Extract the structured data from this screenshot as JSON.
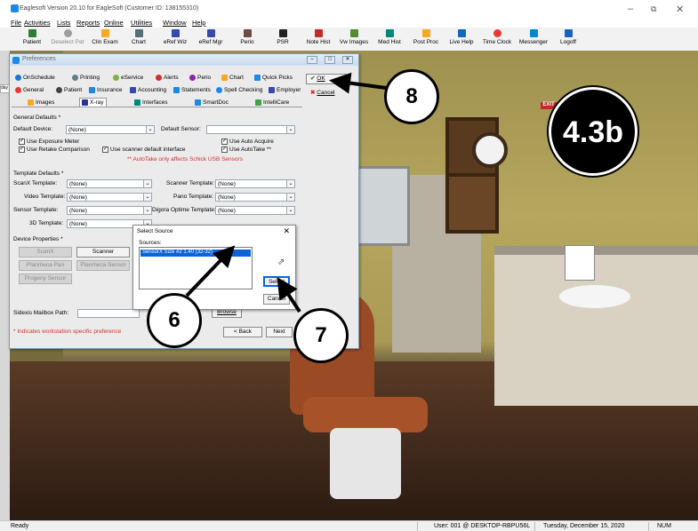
{
  "window": {
    "title": "Eaglesoft Version 20.10 for EagleSoft (Customer ID: 138155310)"
  },
  "menu": [
    "File",
    "Activities",
    "Lists",
    "Reports",
    "Online",
    "Utilities",
    "Window",
    "Help"
  ],
  "toolbar": [
    {
      "label": "Patient",
      "icon": "patient-icon",
      "color": "#2e7d32"
    },
    {
      "label": "Deselect Pat",
      "icon": "deselect-icon",
      "color": "#9e9e9e"
    },
    {
      "label": "Clin Exam",
      "icon": "clin-exam-icon",
      "color": "#f9a825"
    },
    {
      "label": "Chart",
      "icon": "chart-icon",
      "color": "#546e7a"
    },
    {
      "label": "eRef Wiz",
      "icon": "eref-wiz-icon",
      "color": "#3949ab"
    },
    {
      "label": "eRef Mgr",
      "icon": "eref-mgr-icon",
      "color": "#3949ab"
    },
    {
      "label": "Perio",
      "icon": "perio-icon",
      "color": "#6d4c41"
    },
    {
      "label": "PSR",
      "icon": "psr-icon",
      "color": "#212121"
    },
    {
      "label": "Note Hist",
      "icon": "note-hist-icon",
      "color": "#c62828"
    },
    {
      "label": "Vw Images",
      "icon": "images-icon",
      "color": "#558b2f"
    },
    {
      "label": "Med Hist",
      "icon": "med-hist-icon",
      "color": "#00897b"
    },
    {
      "label": "Post Proc",
      "icon": "post-proc-icon",
      "color": "#f9a825"
    },
    {
      "label": "Live Help",
      "icon": "live-help-icon",
      "color": "#1565c0"
    },
    {
      "label": "Time Clock",
      "icon": "time-clock-icon",
      "color": "#e53935"
    },
    {
      "label": "Messenger",
      "icon": "messenger-icon",
      "color": "#0288d1"
    },
    {
      "label": "Logoff",
      "icon": "logoff-icon",
      "color": "#1565c0"
    }
  ],
  "side_tab": "day",
  "preferences": {
    "title": "Preferences",
    "tabs_row1": [
      "OnSchedule",
      "Printing",
      "eService",
      "Alerts",
      "Perio",
      "Chart",
      "Quick Picks"
    ],
    "tabs_row2": [
      "General",
      "Patient",
      "Insurance",
      "Accounting",
      "Statements",
      "Spell Checking",
      "Employer"
    ],
    "tabs_row3": [
      "Images",
      "X-ray",
      "Interfaces",
      "SmartDoc",
      "IntelliCare"
    ],
    "ok_label": "OK",
    "cancel_label": "Cancel",
    "general_defaults_label": "General Defaults *",
    "default_device_label": "Default Device:",
    "default_device_value": "(None)",
    "default_sensor_label": "Default Sensor:",
    "default_sensor_value": "",
    "checks": {
      "use_exposure_meter": "Use Exposure Meter",
      "use_retake_comparison": "Use Retake Comparison",
      "use_scanner_default": "Use scanner default interface",
      "use_auto_acquire": "Use Auto Acquire",
      "use_auto_take": "Use AutoTake **"
    },
    "autotake_note": "** AutoTake only affects Schick USB Sensors",
    "template_defaults_label": "Template Defaults *",
    "templates": {
      "scanx_label": "ScanX Template:",
      "scanx_value": "(None)",
      "scanner_label": "Scanner Template:",
      "scanner_value": "(None)",
      "video_label": "Video Template:",
      "video_value": "(None)",
      "pano_label": "Pano Template:",
      "pano_value": "(None)",
      "sensor_label": "Sensor Template:",
      "sensor_value": "(None)",
      "digora_label": "Digora Optime Template:",
      "digora_value": "(None)",
      "threed_label": "3D Template:",
      "threed_value": "(None)"
    },
    "device_properties_label": "Device Properties *",
    "device_buttons": [
      "ScanX",
      "Scanner",
      "Planmeca Pan",
      "Planmeca Sensor",
      "Progeny Sensor"
    ],
    "sidexis_label": "Sidexis Mailbox Path:",
    "browse_label": "Browse",
    "footnote": "* Indicates workstation specific preference",
    "back_label": "< Back",
    "next_label": "Next"
  },
  "select_source": {
    "title": "Select Source",
    "sources_label": "Sources:",
    "selected_source": "SensorX Size #2 1.40 (32-32)",
    "select_label": "Select",
    "cancel_label": "Cancel"
  },
  "callouts": {
    "six": "6",
    "seven": "7",
    "eight": "8",
    "badge": "4.3b"
  },
  "scene": {
    "exit_sign": "EXIT"
  },
  "status": {
    "ready": "Ready",
    "user": "User: 001 @ DESKTOP-RBPU56L",
    "date": "Tuesday, December 15, 2020",
    "num": "NUM"
  }
}
